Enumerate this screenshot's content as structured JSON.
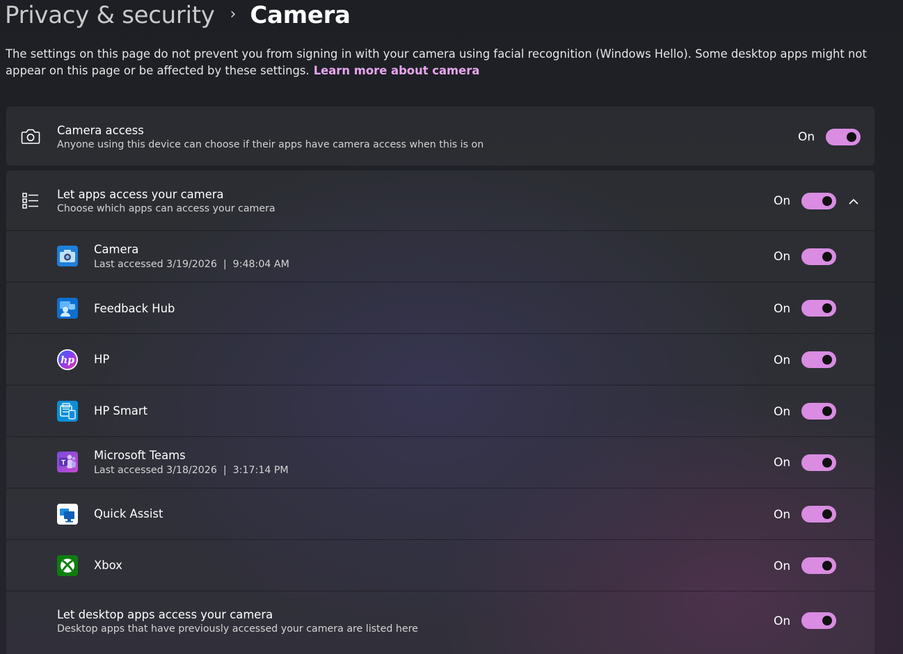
{
  "breadcrumb": {
    "parent": "Privacy & security",
    "separator": "›",
    "current": "Camera"
  },
  "description": {
    "text": "The settings on this page do not prevent you from signing in with your camera using facial recognition (Windows Hello). Some desktop apps might not appear on this page or be affected by these settings.",
    "link": "Learn more about camera"
  },
  "camera_access": {
    "title": "Camera access",
    "subtitle": "Anyone using this device can choose if their apps have camera access when this is on",
    "state": "On",
    "icon": "camera-icon"
  },
  "let_apps": {
    "title": "Let apps access your camera",
    "subtitle": "Choose which apps can access your camera",
    "state": "On",
    "icon": "list-icon",
    "expander": "chevron-up-icon"
  },
  "apps": [
    {
      "name": "Camera",
      "last": "Last accessed 3/19/2026  |  9:48:04 AM",
      "state": "On",
      "icon": "camera-app-icon"
    },
    {
      "name": "Feedback Hub",
      "last": "",
      "state": "On",
      "icon": "feedback-hub-icon"
    },
    {
      "name": "HP",
      "last": "",
      "state": "On",
      "icon": "hp-icon"
    },
    {
      "name": "HP Smart",
      "last": "",
      "state": "On",
      "icon": "hp-smart-icon"
    },
    {
      "name": "Microsoft Teams",
      "last": "Last accessed 3/18/2026  |  3:17:14 PM",
      "state": "On",
      "icon": "teams-icon"
    },
    {
      "name": "Quick Assist",
      "last": "",
      "state": "On",
      "icon": "quick-assist-icon"
    },
    {
      "name": "Xbox",
      "last": "",
      "state": "On",
      "icon": "xbox-icon"
    }
  ],
  "desktop_apps": {
    "title": "Let desktop apps access your camera",
    "subtitle": "Desktop apps that have previously accessed your camera are listed here",
    "state": "On"
  },
  "colors": {
    "accent": "#d98ce2",
    "link": "#e7a5ee"
  }
}
